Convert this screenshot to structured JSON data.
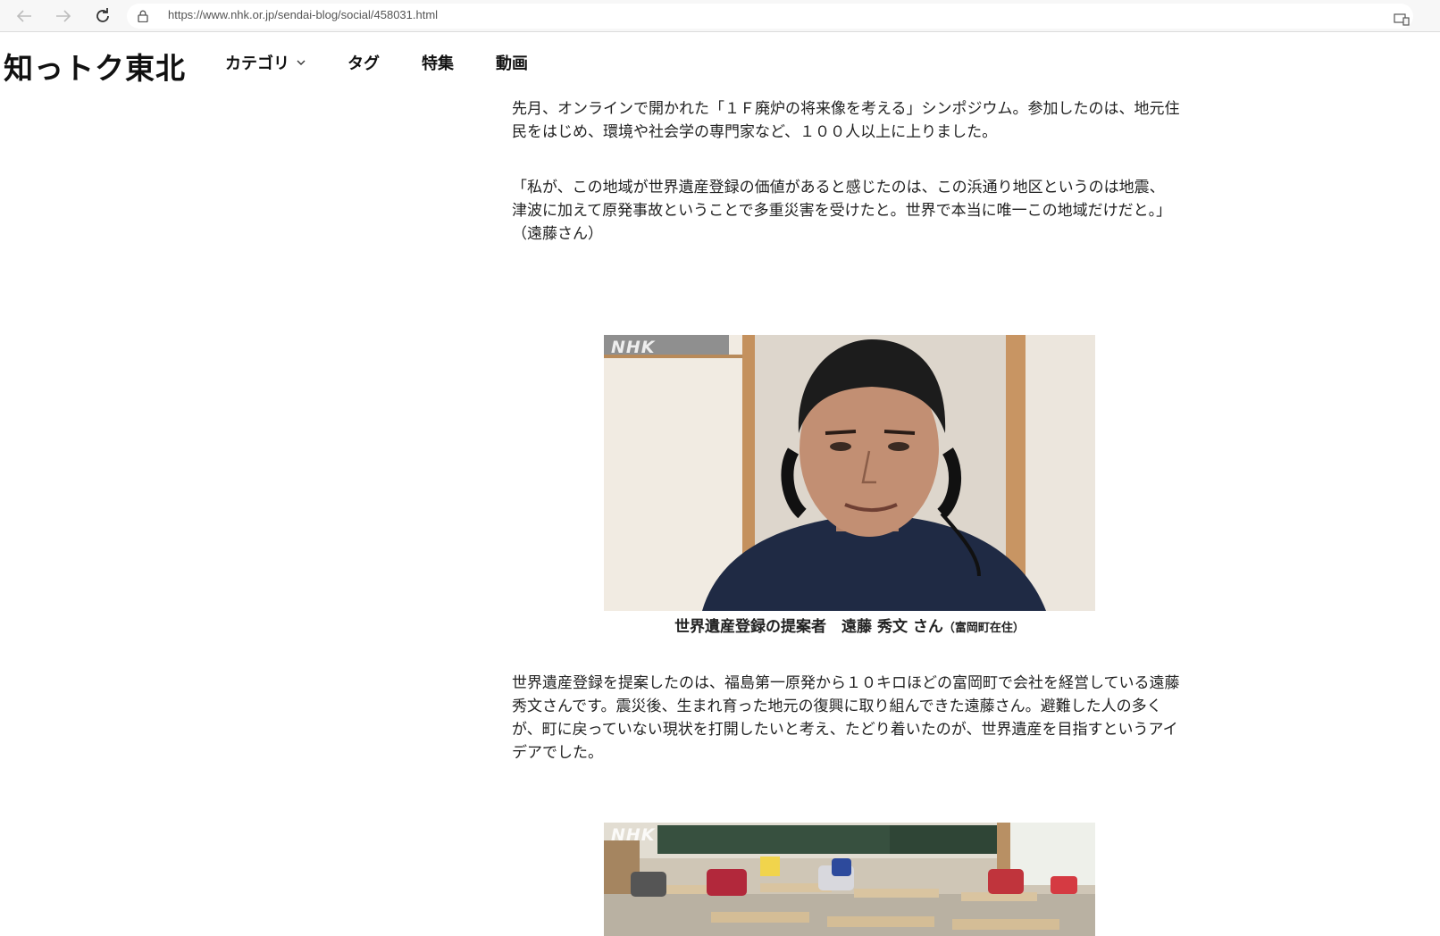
{
  "browser": {
    "url": "https://www.nhk.or.jp/sendai-blog/social/458031.html"
  },
  "header": {
    "logo": "知っトク東北",
    "nav": [
      {
        "label": "カテゴリ",
        "has_dropdown": true
      },
      {
        "label": "タグ",
        "has_dropdown": false
      },
      {
        "label": "特集",
        "has_dropdown": false
      },
      {
        "label": "動画",
        "has_dropdown": false
      }
    ]
  },
  "article": {
    "paragraph1": "先月、オンラインで開かれた「１Ｆ廃炉の将来像を考える」シンポジウム。参加したのは、地元住民をはじめ、環境や社会学の専門家など、１００人以上に上りました。",
    "paragraph2": "「私が、この地域が世界遺産登録の価値があると感じたのは、この浜通り地区というのは地震、津波に加えて原発事故ということで多重災害を受けたと。世界で本当に唯一この地域だけだと。」（遠藤さん）",
    "photo1": {
      "watermark": "NHK",
      "caption_main": "世界遺産登録の提案者　遠藤 秀文 さん",
      "caption_sub": "（富岡町在住）"
    },
    "paragraph3": "世界遺産登録を提案したのは、福島第一原発から１０キロほどの富岡町で会社を経営している遠藤秀文さんです。震災後、生まれ育った地元の復興に取り組んできた遠藤さん。避難した人の多くが、町に戻っていない現状を打開したいと考え、たどり着いたのが、世界遺産を目指すというアイデアでした。",
    "photo2": {
      "watermark": "NHK"
    }
  },
  "colors": {
    "text": "#222222",
    "chrome": "#f7f7f7"
  }
}
